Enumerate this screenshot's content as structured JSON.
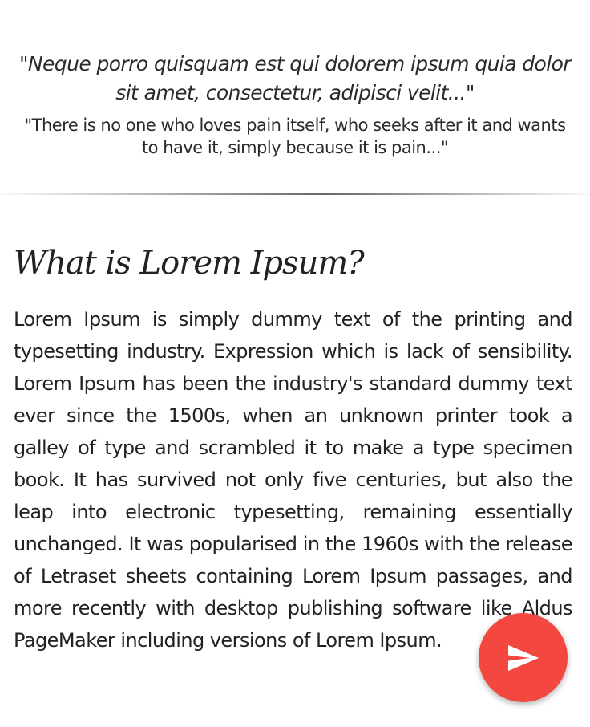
{
  "quote": {
    "latin": "\"Neque porro quisquam est qui dolorem ipsum quia dolor sit amet, consectetur, adipisci velit...\"",
    "english": "\"There is no one who loves pain itself, who seeks after it and wants to have it, simply because it is pain...\""
  },
  "section": {
    "heading": "What is Lorem Ipsum?",
    "body": "Lorem Ipsum is simply dummy text of the printing and typesetting industry. Expression which is lack of sensibility. Lorem Ipsum has been the industry's standard dummy text ever since the 1500s, when an unknown printer took a galley of type and scrambled it to make a type specimen book. It has survived not only five centuries, but also the leap into electronic typesetting, remaining essentially unchanged. It was popularised in the 1960s with the release of Letraset sheets containing Lorem Ipsum passages, and more recently with desktop publishing software like Aldus PageMaker including versions of Lorem Ipsum."
  },
  "fab": {
    "icon": "send-icon",
    "color": "#f4473f"
  }
}
